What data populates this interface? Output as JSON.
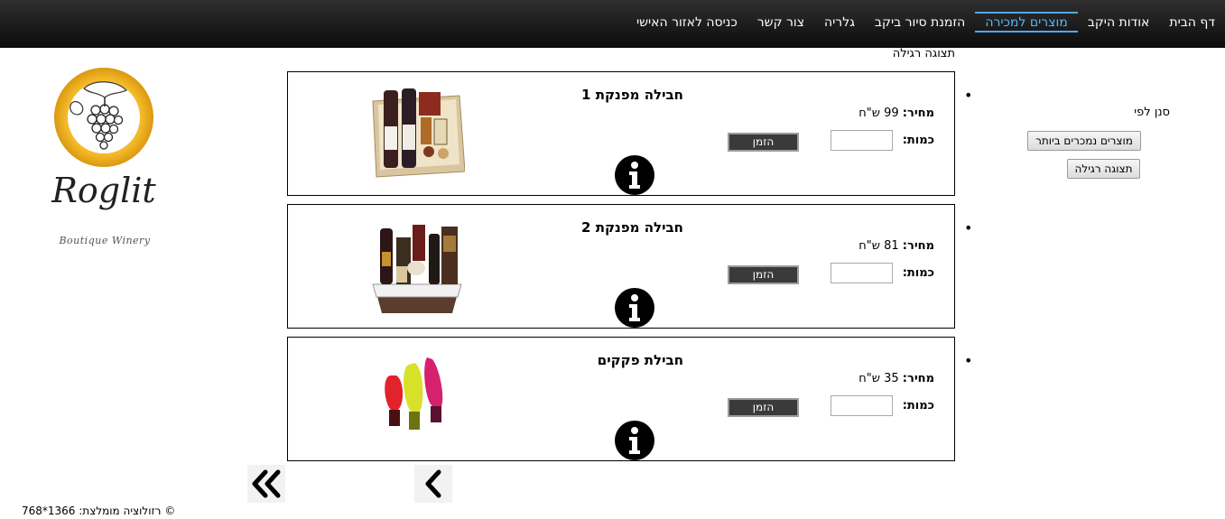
{
  "nav": {
    "items": [
      {
        "label": "דף הבית",
        "name": "nav-home"
      },
      {
        "label": "אודות היקב",
        "name": "nav-about"
      },
      {
        "label": "מוצרים למכירה",
        "name": "nav-products"
      },
      {
        "label": "הזמנת סיור ביקב",
        "name": "nav-tour"
      },
      {
        "label": "גלריה",
        "name": "nav-gallery"
      },
      {
        "label": "צור קשר",
        "name": "nav-contact"
      },
      {
        "label": "כניסה לאזור האישי",
        "name": "nav-login"
      }
    ],
    "active": "מוצרים למכירה"
  },
  "view_label": "תצוגה רגילה",
  "logo": {
    "brand": "Roglit",
    "tagline": "Boutique Winery"
  },
  "filter": {
    "label": "סנן לפי",
    "best_sellers": "מוצרים נמכרים ביותר",
    "regular_view": "תצוגה רגילה"
  },
  "labels": {
    "price": "מחיר:",
    "qty": "כמות:",
    "order": "הזמן"
  },
  "products": [
    {
      "title": "חבילה מפנקת 1",
      "price": "99 ש\"ח",
      "qty": ""
    },
    {
      "title": "חבילה מפנקת 2",
      "price": "81 ש\"ח",
      "qty": ""
    },
    {
      "title": "חבילת פקקים",
      "price": "35 ש\"ח",
      "qty": ""
    }
  ],
  "pager": {
    "first_icon": "double-chevron-left-icon",
    "prev_icon": "chevron-left-icon"
  },
  "footer": {
    "text": "© רזולוציה מומלצת: 1366*768"
  },
  "colors": {
    "topbar": "#1a1a1a",
    "active_nav": "#56b8ff",
    "order_button": "#3a3a3a"
  }
}
